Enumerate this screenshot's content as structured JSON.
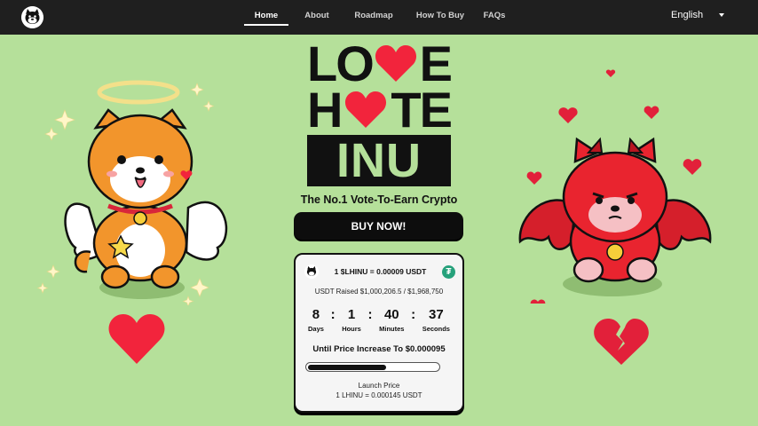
{
  "nav": {
    "items": [
      {
        "label": "Home",
        "active": true
      },
      {
        "label": "About"
      },
      {
        "label": "Roadmap"
      },
      {
        "label": "How To Buy"
      },
      {
        "label": "FAQs"
      }
    ],
    "language": "English"
  },
  "hero": {
    "title_line1_a": "LO",
    "title_line1_b": "E",
    "title_line2_a": "H",
    "title_line2_b": "TE",
    "title_line3": "INU",
    "tagline": "The No.1 Vote-To-Earn Crypto",
    "buy_label": "BUY NOW!"
  },
  "presale": {
    "price": "1 $LHINU = 0.00009 USDT",
    "raised": "USDT Raised $1,000,206.5 / $1,968,750",
    "countdown": [
      {
        "value": "8",
        "label": "Days"
      },
      {
        "value": "1",
        "label": "Hours"
      },
      {
        "value": "40",
        "label": "Minutes"
      },
      {
        "value": "37",
        "label": "Seconds"
      }
    ],
    "next_price": "Until Price Increase To $0.000095",
    "progress": 0.6,
    "launch_label": "Launch Price",
    "launch_price": "1 LHINU = 0.000145 USDT"
  },
  "colors": {
    "background": "#b5e09a",
    "nav": "#1f1f1f",
    "heart": "#f2243c",
    "tether": "#26a17b"
  },
  "icons": {
    "logo": "dog-face-icon",
    "language_caret": "chevron-down-icon",
    "title_heart": "heart-icon",
    "usdt": "tether-icon"
  }
}
